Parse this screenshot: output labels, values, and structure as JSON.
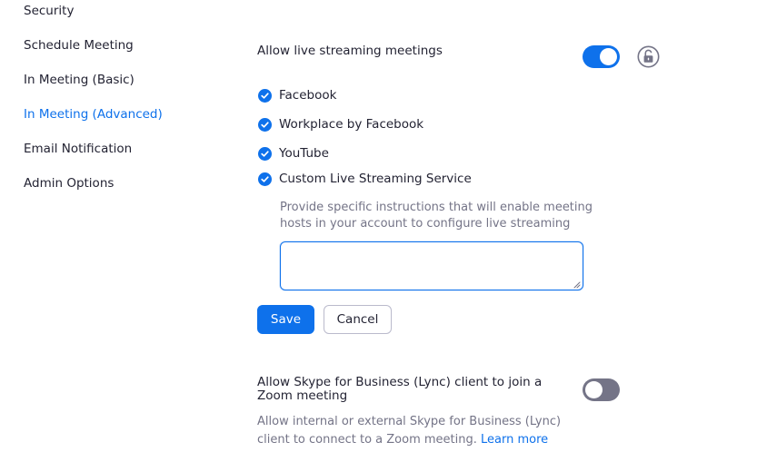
{
  "sidebar": {
    "items": [
      {
        "label": "Security"
      },
      {
        "label": "Schedule Meeting"
      },
      {
        "label": "In Meeting (Basic)"
      },
      {
        "label": "In Meeting (Advanced)",
        "active": true
      },
      {
        "label": "Email Notification"
      },
      {
        "label": "Admin Options"
      }
    ]
  },
  "live_streaming": {
    "title": "Allow live streaming meetings",
    "enabled": true,
    "lock_icon": "unlocked-padlock-icon",
    "options": [
      {
        "label": "Facebook",
        "checked": true
      },
      {
        "label": "Workplace by Facebook",
        "checked": true
      },
      {
        "label": "YouTube",
        "checked": true
      },
      {
        "label": "Custom Live Streaming Service",
        "checked": true
      }
    ],
    "instructions_line1": "Provide specific instructions that will enable meeting",
    "instructions_line2": "hosts in your account to configure live streaming",
    "instructions_value": "",
    "save_label": "Save",
    "cancel_label": "Cancel"
  },
  "skype": {
    "title": "Allow Skype for Business (Lync) client to join a Zoom meeting",
    "enabled": false,
    "desc_line1": "Allow internal or external Skype for Business (Lync)",
    "desc_line2": "client to connect to a Zoom meeting.",
    "learn_more": "Learn more"
  },
  "colors": {
    "accent": "#0e71eb",
    "text": "#232333",
    "muted": "#747487",
    "toggle_off": "#747487"
  }
}
